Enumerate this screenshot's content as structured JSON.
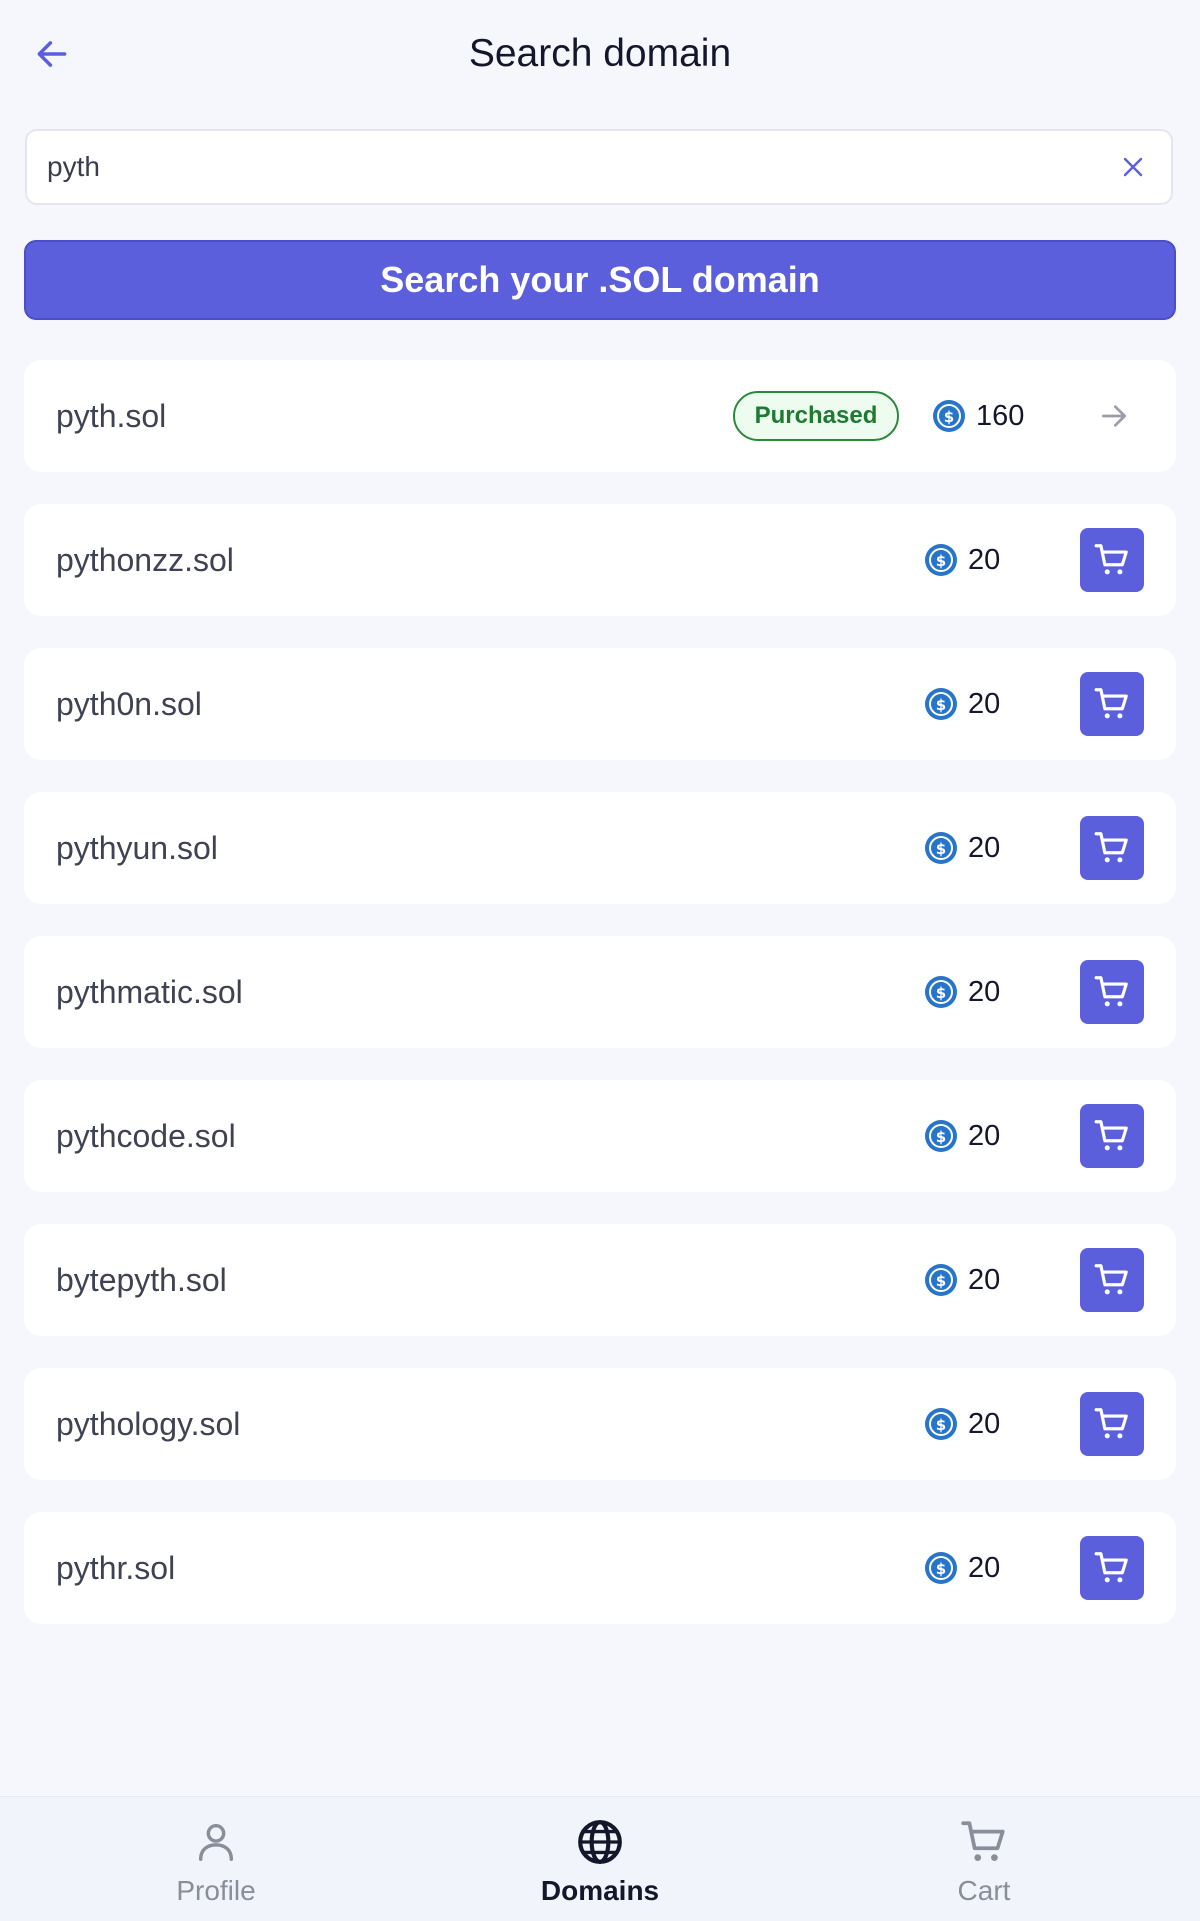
{
  "header": {
    "title": "Search domain",
    "back_icon": "arrow-left-icon"
  },
  "search": {
    "value": "pyth",
    "clear_icon": "close-icon",
    "button_label": "Search your .SOL domain"
  },
  "results": [
    {
      "name": "pyth.sol",
      "badge": "Purchased",
      "price": "160",
      "action": "arrow-right-icon"
    },
    {
      "name": "pythonzz.sol",
      "price": "20",
      "action": "cart-icon"
    },
    {
      "name": "pyth0n.sol",
      "price": "20",
      "action": "cart-icon"
    },
    {
      "name": "pythyun.sol",
      "price": "20",
      "action": "cart-icon"
    },
    {
      "name": "pythmatic.sol",
      "price": "20",
      "action": "cart-icon"
    },
    {
      "name": "pythcode.sol",
      "price": "20",
      "action": "cart-icon"
    },
    {
      "name": "bytepyth.sol",
      "price": "20",
      "action": "cart-icon"
    },
    {
      "name": "pythology.sol",
      "price": "20",
      "action": "cart-icon"
    },
    {
      "name": "pythr.sol",
      "price": "20",
      "action": "cart-icon"
    }
  ],
  "nav": {
    "items": [
      {
        "label": "Profile",
        "icon": "user-icon",
        "active": false
      },
      {
        "label": "Domains",
        "icon": "globe-icon",
        "active": true
      },
      {
        "label": "Cart",
        "icon": "cart-icon",
        "active": false
      }
    ]
  },
  "colors": {
    "accent": "#5b5fdb",
    "background": "#f5f7fd",
    "purchased_green": "#2a8a3c",
    "coin_blue": "#2775ca"
  }
}
